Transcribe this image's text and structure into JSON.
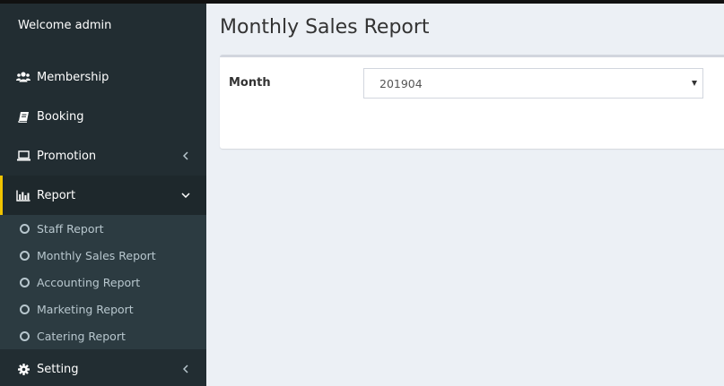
{
  "sidebar": {
    "welcome": "Welcome admin",
    "items": [
      {
        "label": "Membership",
        "icon": "users-icon"
      },
      {
        "label": "Booking",
        "icon": "book-icon"
      },
      {
        "label": "Promotion",
        "icon": "laptop-icon",
        "chevron": "chevron-left-icon"
      },
      {
        "label": "Report",
        "icon": "bar-chart-icon",
        "chevron": "chevron-down-icon",
        "active": true
      },
      {
        "label": "Setting",
        "icon": "gear-icon",
        "chevron": "chevron-left-icon"
      }
    ],
    "report_submenu": [
      {
        "label": "Staff Report"
      },
      {
        "label": "Monthly Sales Report"
      },
      {
        "label": "Accounting Report"
      },
      {
        "label": "Marketing Report"
      },
      {
        "label": "Catering Report"
      }
    ]
  },
  "main": {
    "title": "Monthly Sales Report",
    "form": {
      "month_label": "Month",
      "month_value": "201904"
    }
  },
  "colors": {
    "sidebar_bg": "#222d32",
    "submenu_bg": "#2c3b41",
    "active_accent": "#f0c300",
    "content_bg": "#ecf0f5"
  }
}
